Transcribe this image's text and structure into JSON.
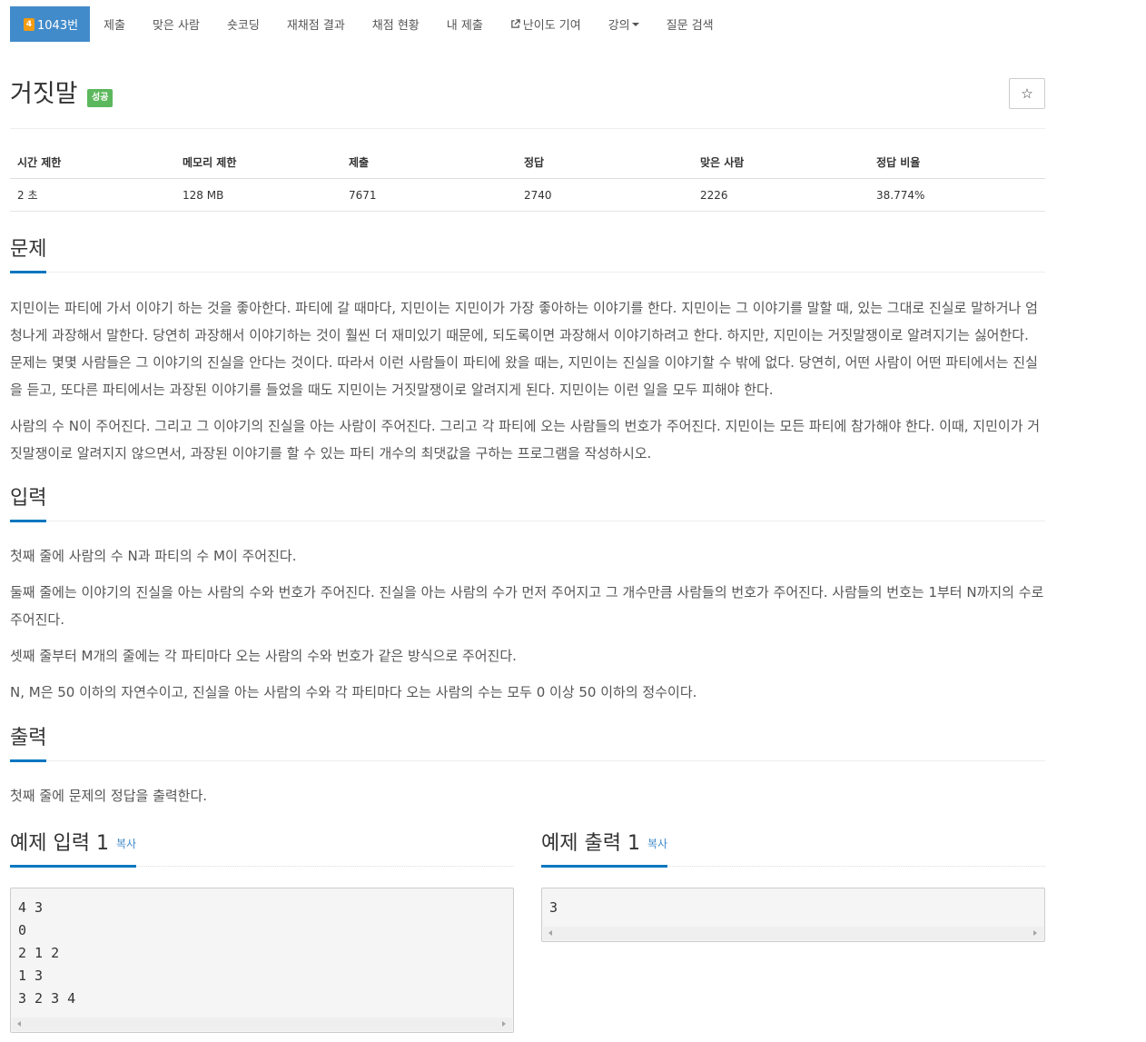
{
  "nav": {
    "tier_badge": "4",
    "items": [
      "1043번",
      "제출",
      "맞은 사람",
      "숏코딩",
      "재채점 결과",
      "채점 현황",
      "내 제출",
      "난이도 기여",
      "강의",
      "질문 검색"
    ]
  },
  "problem": {
    "title": "거짓말",
    "result": "성공",
    "star": "☆"
  },
  "info_table": {
    "headers": [
      "시간 제한",
      "메모리 제한",
      "제출",
      "정답",
      "맞은 사람",
      "정답 비율"
    ],
    "values": [
      "2 초",
      "128 MB",
      "7671",
      "2740",
      "2226",
      "38.774%"
    ]
  },
  "description": {
    "heading": "문제",
    "paragraphs": [
      "지민이는 파티에 가서 이야기 하는 것을 좋아한다. 파티에 갈 때마다, 지민이는 지민이가 가장 좋아하는 이야기를 한다. 지민이는 그 이야기를 말할 때, 있는 그대로 진실로 말하거나 엄청나게 과장해서 말한다. 당연히 과장해서 이야기하는 것이 훨씬 더 재미있기 때문에, 되도록이면 과장해서 이야기하려고 한다. 하지만, 지민이는 거짓말쟁이로 알려지기는 싫어한다. 문제는 몇몇 사람들은 그 이야기의 진실을 안다는 것이다. 따라서 이런 사람들이 파티에 왔을 때는, 지민이는 진실을 이야기할 수 밖에 없다. 당연히, 어떤 사람이 어떤 파티에서는 진실을 듣고, 또다른 파티에서는 과장된 이야기를 들었을 때도 지민이는 거짓말쟁이로 알려지게 된다. 지민이는 이런 일을 모두 피해야 한다.",
      "사람의 수 N이 주어진다. 그리고 그 이야기의 진실을 아는 사람이 주어진다. 그리고 각 파티에 오는 사람들의 번호가 주어진다. 지민이는 모든 파티에 참가해야 한다. 이때, 지민이가 거짓말쟁이로 알려지지 않으면서, 과장된 이야기를 할 수 있는 파티 개수의 최댓값을 구하는 프로그램을 작성하시오."
    ]
  },
  "input": {
    "heading": "입력",
    "paragraphs": [
      "첫째 줄에 사람의 수 N과 파티의 수 M이 주어진다.",
      "둘째 줄에는 이야기의 진실을 아는 사람의 수와 번호가 주어진다. 진실을 아는 사람의 수가 먼저 주어지고 그 개수만큼 사람들의 번호가 주어진다. 사람들의 번호는 1부터 N까지의 수로 주어진다.",
      "셋째 줄부터 M개의 줄에는 각 파티마다 오는 사람의 수와 번호가 같은 방식으로 주어진다.",
      "N, M은 50 이하의 자연수이고, 진실을 아는 사람의 수와 각 파티마다 오는 사람의 수는 모두 0 이상 50 이하의 정수이다."
    ]
  },
  "output": {
    "heading": "출력",
    "paragraphs": [
      "첫째 줄에 문제의 정답을 출력한다."
    ]
  },
  "samples": {
    "copy_label": "복사",
    "input_heading": "예제 입력 1",
    "input_text": "4 3\n0\n2 1 2\n1 3\n3 2 3 4",
    "output_heading": "예제 출력 1",
    "output_text": "3"
  }
}
